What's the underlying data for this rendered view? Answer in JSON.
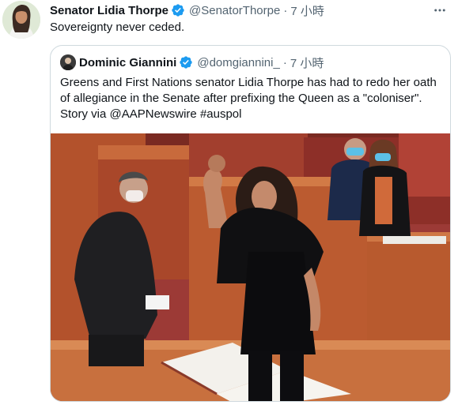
{
  "tweet": {
    "author_name": "Senator Lidia Thorpe",
    "handle": "@SenatorThorpe",
    "separator": "·",
    "time": "7 小時",
    "text": "Sovereignty never ceded."
  },
  "quote": {
    "author_name": "Dominic Giannini",
    "handle": "@domgiannini_",
    "separator": "·",
    "time": "7 小時",
    "text_lines": [
      "Greens and First Nations senator Lidia Thorpe has had to redo her oath",
      "of allegiance in the Senate after prefixing the Queen as a \"coloniser\".",
      "Story via @AAPNewswire #auspol"
    ]
  },
  "icons": {
    "verified": "verified-badge-icon",
    "more": "more-options-icon"
  },
  "colors": {
    "verified_blue": "#1d9bf0",
    "secondary_text": "#536471",
    "border": "#cfd9de",
    "bench_red": "#a33a2f",
    "wood": "#c2562c"
  }
}
